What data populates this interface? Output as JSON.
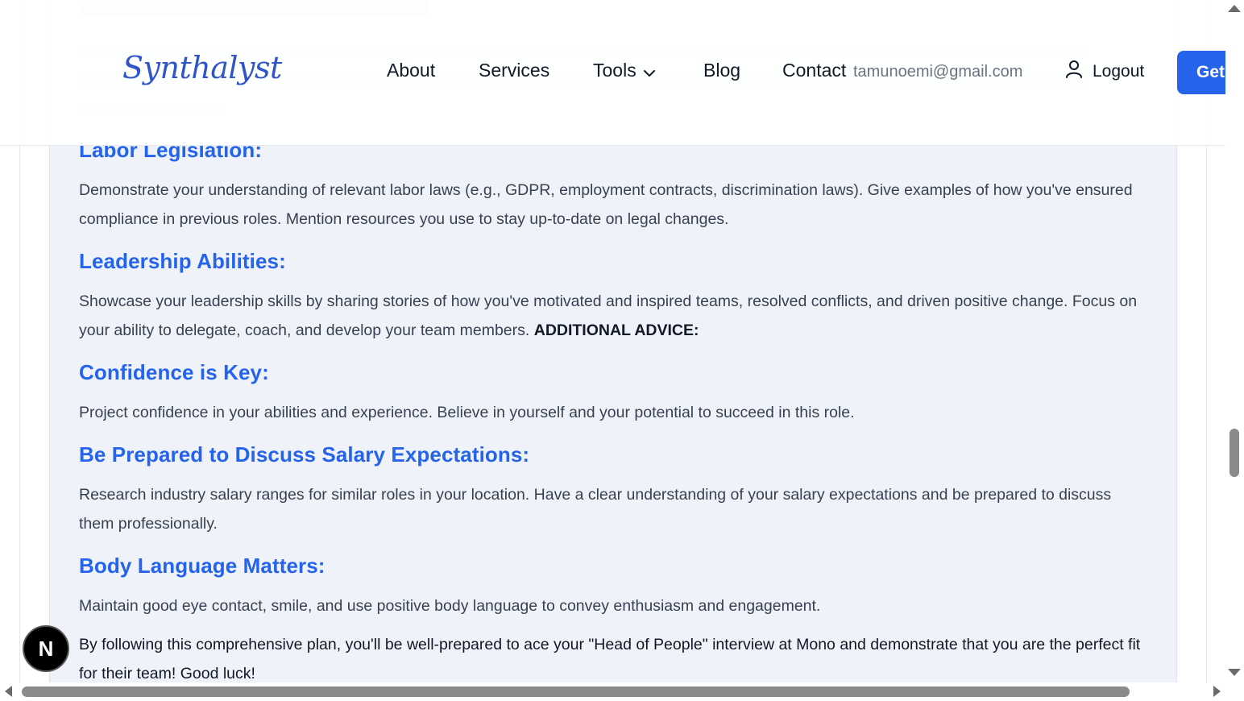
{
  "header": {
    "logo": "Synthalyst",
    "nav": {
      "about": "About",
      "services": "Services",
      "tools": "Tools",
      "blog": "Blog",
      "contact": "Contact"
    },
    "user_email": "tamunoemi@gmail.com",
    "logout_label": "Logout",
    "cta_label": "Get"
  },
  "sections": [
    {
      "heading": "Labor Legislation:",
      "body": "Demonstrate your understanding of relevant labor laws (e.g., GDPR, employment contracts, discrimination laws). Give examples of how you've ensured compliance in previous roles. Mention resources you use to stay up-to-date on legal changes."
    },
    {
      "heading": "Leadership Abilities:",
      "body": "Showcase your leadership skills by sharing stories of how you've motivated and inspired teams, resolved conflicts, and driven positive change. Focus on your ability to delegate, coach, and develop your team members.",
      "body_strong": "ADDITIONAL ADVICE:"
    },
    {
      "heading": "Confidence is Key:",
      "body": "Project confidence in your abilities and experience. Believe in yourself and your potential to succeed in this role."
    },
    {
      "heading": "Be Prepared to Discuss Salary Expectations:",
      "body": "Research industry salary ranges for similar roles in your location. Have a clear understanding of your salary expectations and be prepared to discuss them professionally."
    },
    {
      "heading": "Body Language Matters:",
      "body": "Maintain good eye contact, smile, and use positive body language to convey enthusiasm and engagement."
    }
  ],
  "closing": "By following this comprehensive plan, you'll be well-prepared to ace your \"Head of People\" interview at Mono and demonstrate that you are the perfect fit for their team! Good luck!",
  "badge": "N",
  "colors": {
    "accent": "#2563eb",
    "card_bg": "#eff3f9",
    "body_text": "#374151"
  },
  "icons": {
    "chevron": "chevron-down-icon",
    "user": "user-icon"
  }
}
